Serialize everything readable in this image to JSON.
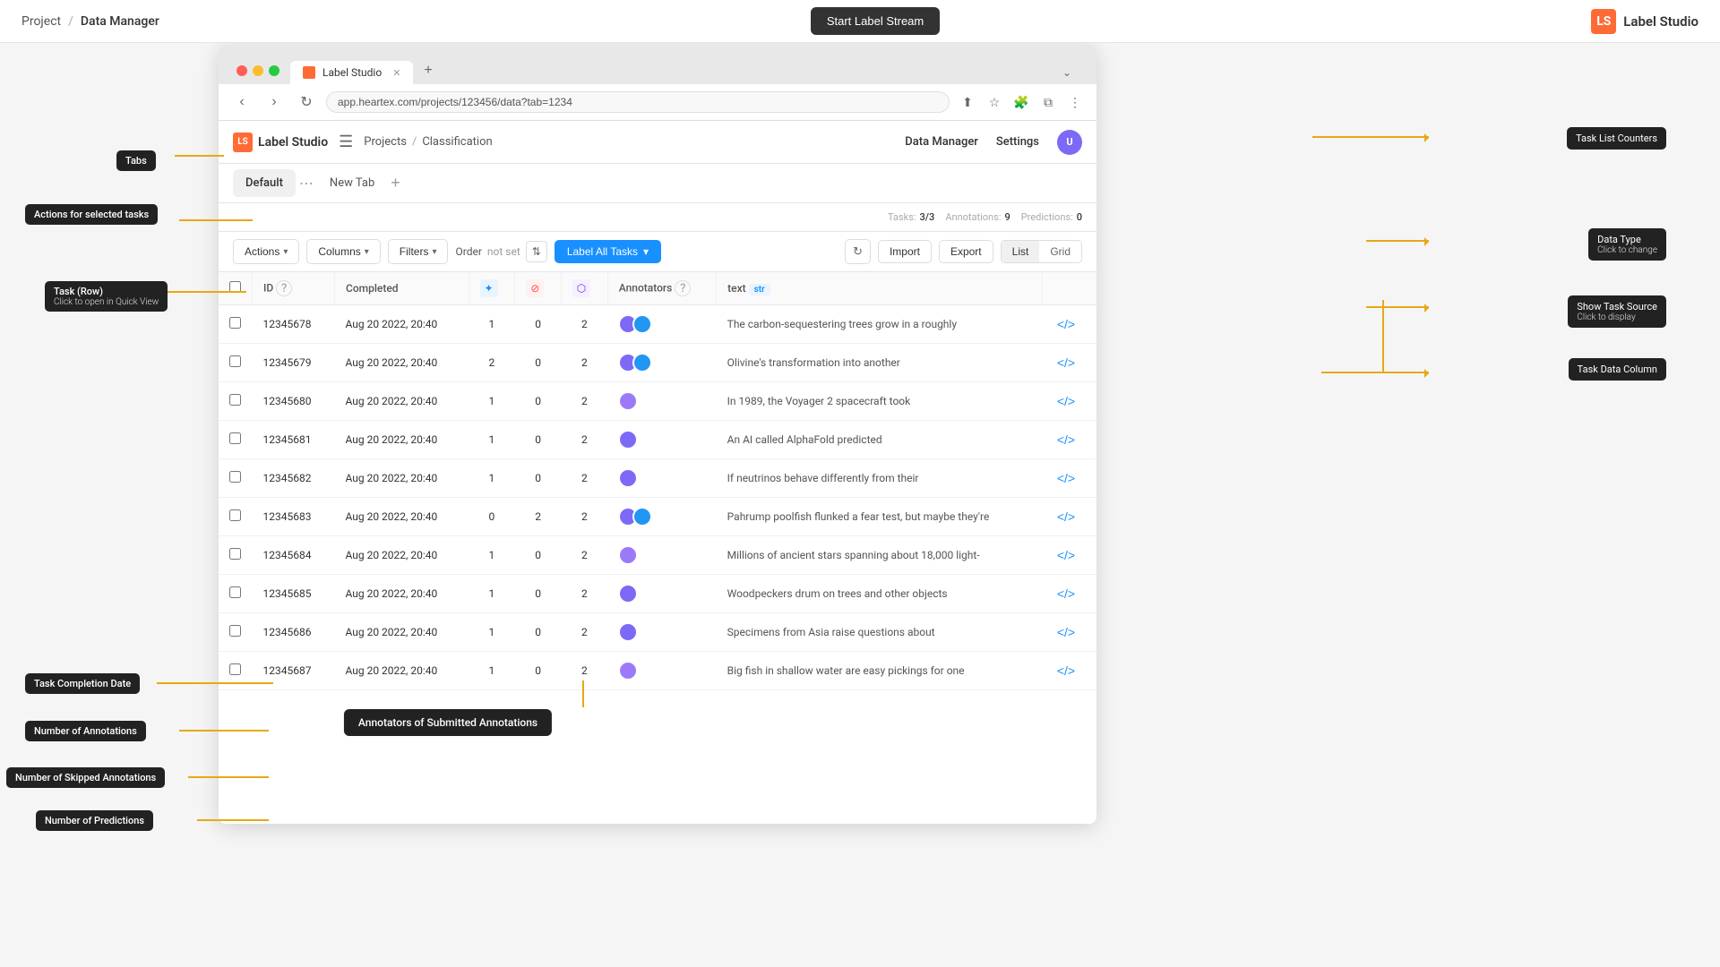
{
  "topbar": {
    "breadcrumb_project": "Project",
    "breadcrumb_sep": "/",
    "breadcrumb_current": "Data Manager",
    "start_label_btn": "Start Label Stream",
    "logo": "Label Studio"
  },
  "browser": {
    "tab_label": "Label Studio",
    "tab_new": "+",
    "address": "app.heartex.com/projects/123456/data?tab=1234"
  },
  "app": {
    "logo": "Label Studio",
    "breadcrumb_projects": "Projects",
    "breadcrumb_sep": "/",
    "breadcrumb_current": "Classification",
    "nav_data_manager": "Data Manager",
    "nav_settings": "Settings",
    "tabs": {
      "default": "Default",
      "new_tab": "New Tab"
    },
    "toolbar": {
      "actions": "Actions",
      "columns": "Columns",
      "filters": "Filters",
      "order_label": "Order",
      "order_value": "not set",
      "label_all": "Label All Tasks",
      "import": "Import",
      "export": "Export",
      "view_list": "List",
      "view_grid": "Grid",
      "tasks_counter": "Tasks: 3/3",
      "annotations_counter": "Annotations: 9",
      "predictions_counter": "Predictions: 0"
    },
    "table": {
      "headers": [
        "",
        "ID",
        "Completed",
        "",
        "",
        "",
        "Annotators",
        "",
        "text",
        ""
      ],
      "rows": [
        {
          "id": "12345678",
          "completed": "Aug 20 2022, 20:40",
          "annotations": "1",
          "skipped": "0",
          "predictions": "2",
          "annotators": [
            "#7c6af7",
            "#2196f3"
          ],
          "text": "The carbon-sequestering trees grow in a roughly"
        },
        {
          "id": "12345679",
          "completed": "Aug 20 2022, 20:40",
          "annotations": "2",
          "skipped": "0",
          "predictions": "2",
          "annotators": [
            "#7c6af7",
            "#2196f3"
          ],
          "text": "Olivine's transformation into another"
        },
        {
          "id": "12345680",
          "completed": "Aug 20 2022, 20:40",
          "annotations": "1",
          "skipped": "0",
          "predictions": "2",
          "annotators": [
            "#9c7af7"
          ],
          "text": "In 1989, the Voyager 2 spacecraft took"
        },
        {
          "id": "12345681",
          "completed": "Aug 20 2022, 20:40",
          "annotations": "1",
          "skipped": "0",
          "predictions": "2",
          "annotators": [
            "#7c6af7"
          ],
          "text": "An AI called AlphaFold predicted"
        },
        {
          "id": "12345682",
          "completed": "Aug 20 2022, 20:40",
          "annotations": "1",
          "skipped": "0",
          "predictions": "2",
          "annotators": [
            "#7c6af7"
          ],
          "text": "If neutrinos behave differently from their"
        },
        {
          "id": "12345683",
          "completed": "Aug 20 2022, 20:40",
          "annotations": "0",
          "skipped": "2",
          "predictions": "2",
          "annotators": [
            "#7c6af7",
            "#2196f3"
          ],
          "text": "Pahrump poolfish flunked a fear test, but maybe they're"
        },
        {
          "id": "12345684",
          "completed": "Aug 20 2022, 20:40",
          "annotations": "1",
          "skipped": "0",
          "predictions": "2",
          "annotators": [
            "#9c7af7"
          ],
          "text": "Millions of ancient stars spanning about 18,000 light-"
        },
        {
          "id": "12345685",
          "completed": "Aug 20 2022, 20:40",
          "annotations": "1",
          "skipped": "0",
          "predictions": "2",
          "annotators": [
            "#7c6af7"
          ],
          "text": "Woodpeckers drum on trees and other objects"
        },
        {
          "id": "12345686",
          "completed": "Aug 20 2022, 20:40",
          "annotations": "1",
          "skipped": "0",
          "predictions": "2",
          "annotators": [
            "#7c6af7"
          ],
          "text": "Specimens from Asia raise questions about"
        },
        {
          "id": "12345687",
          "completed": "Aug 20 2022, 20:40",
          "annotations": "1",
          "skipped": "0",
          "predictions": "2",
          "annotators": [
            "#9c7af7"
          ],
          "text": "Big fish in shallow water are easy pickings for one"
        }
      ]
    }
  },
  "labels": {
    "tabs": "Tabs",
    "actions_for_selected": "Actions for selected tasks",
    "task_row": "Task (Row)",
    "task_row_sub": "Click to open in Quick View",
    "task_completion_date": "Task Completion Date",
    "number_of_annotations": "Number of Annotations",
    "number_of_skipped": "Number of Skipped Annotations",
    "number_of_predictions": "Number of Predictions",
    "annotators_submitted": "Annotators of Submitted Annotations",
    "task_data_column": "Task Data Column",
    "data_type": "Data Type",
    "data_type_sub": "Click to change",
    "show_task_source": "Show Task Source",
    "show_task_source_sub": "Click to display",
    "task_list_counters": "Task List Counters",
    "actions": "Actions"
  },
  "colors": {
    "orange_connector": "#e6a817",
    "accent": "#1890ff",
    "dark_tooltip": "#222"
  }
}
